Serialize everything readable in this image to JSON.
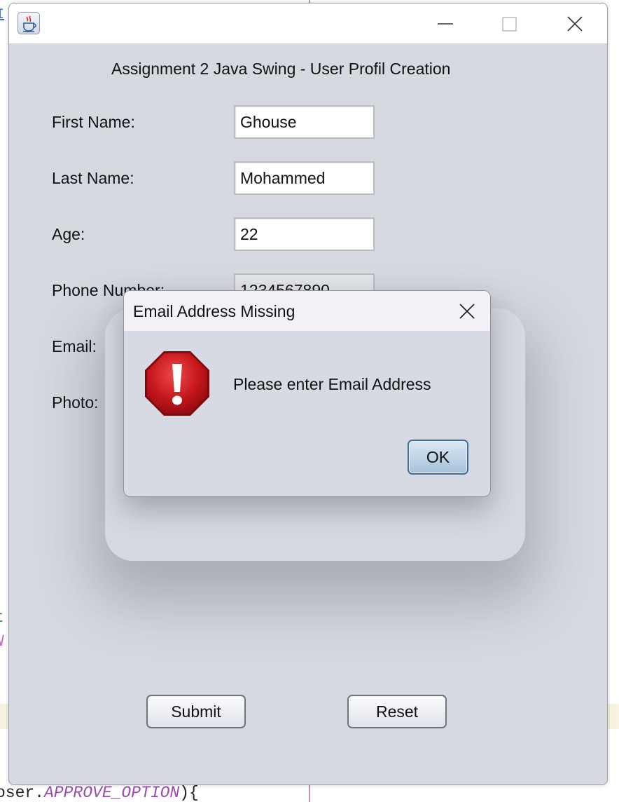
{
  "background": {
    "link_fragment": "I",
    "code_line_t": "t",
    "code_line_n": "N",
    "code_bottom_prefix": "oser.",
    "code_bottom_keyword": "APPROVE_OPTION",
    "code_bottom_suffix": "){"
  },
  "window": {
    "icon": "java-coffee-cup-icon",
    "controls": [
      "minimize-icon",
      "maximize-icon",
      "close-icon"
    ]
  },
  "form": {
    "title": "Assignment 2 Java Swing - User Profil Creation",
    "first_name": {
      "label": "First Name:",
      "value": "Ghouse"
    },
    "last_name": {
      "label": "Last Name:",
      "value": "Mohammed"
    },
    "age": {
      "label": "Age:",
      "value": "22"
    },
    "phone": {
      "label": "Phone Number:",
      "value": "1234567890"
    },
    "email": {
      "label": "Email:"
    },
    "photo": {
      "label": "Photo:"
    },
    "submit_label": "Submit",
    "reset_label": "Reset"
  },
  "dialog": {
    "title": "Email Address Missing",
    "message": "Please enter Email Address",
    "icon": "error-octagon-icon",
    "ok_label": "OK"
  },
  "colors": {
    "window_bg": "#d6d9e0",
    "error_red": "#c4161c",
    "ok_button": "#a6c2dc"
  }
}
